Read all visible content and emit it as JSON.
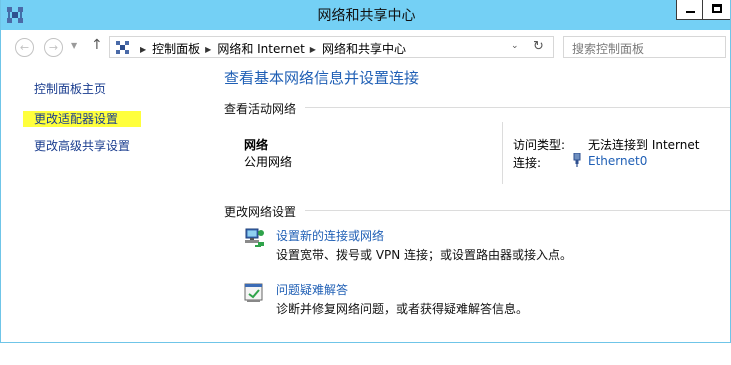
{
  "window": {
    "title": "网络和共享中心"
  },
  "address_bar": {
    "breadcrumbs": [
      "控制面板",
      "网络和 Internet",
      "网络和共享中心"
    ],
    "search_placeholder": "搜索控制面板"
  },
  "left_nav": {
    "items": [
      {
        "label": "控制面板主页"
      },
      {
        "label": "更改适配器设置",
        "highlight_color": "#ffff3c"
      },
      {
        "label": "更改高级共享设置"
      }
    ]
  },
  "main": {
    "title": "查看基本网络信息并设置连接",
    "active_networks_header": "查看活动网络",
    "network": {
      "name": "网络",
      "type": "公用网络",
      "access_type_label": "访问类型:",
      "access_type_value": "无法连接到 Internet",
      "connection_label": "连接:",
      "connection_value": "Ethernet0"
    },
    "change_settings_header": "更改网络设置",
    "tasks": [
      {
        "icon": "network-setup-icon",
        "link": "设置新的连接或网络",
        "description": "设置宽带、拨号或 VPN 连接；或设置路由器或接入点。"
      },
      {
        "icon": "troubleshoot-icon",
        "link": "问题疑难解答",
        "description": "诊断并修复网络问题，或者获得疑难解答信息。"
      }
    ]
  },
  "colors": {
    "titlebar": "#74d0f5",
    "link": "#1f5fb5",
    "nav_link": "#1a3d8f"
  }
}
